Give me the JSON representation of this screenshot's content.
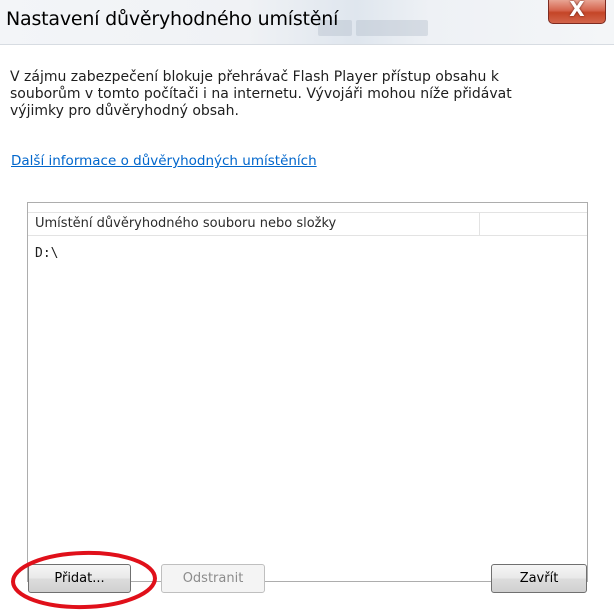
{
  "window": {
    "title": "Nastavení důvěryhodného umístění",
    "close_glyph": "X",
    "close_icon": "close-icon"
  },
  "content": {
    "description": "V zájmu zabezpečení blokuje přehrávač Flash Player přístup obsahu k souborům v tomto počítači i na internetu. Vývojáři mohou níže přidávat výjimky pro důvěryhodný obsah.",
    "info_link": "Další informace o důvěryhodných umístěních"
  },
  "list": {
    "column_header": "Umístění důvěryhodného souboru nebo složky",
    "items": [
      "D:\\"
    ]
  },
  "buttons": {
    "add": "Přidat...",
    "remove": "Odstranit",
    "close": "Zavřít"
  },
  "colors": {
    "highlight": "#e0101a",
    "link": "#0066cc",
    "close_button": "#c44527"
  }
}
